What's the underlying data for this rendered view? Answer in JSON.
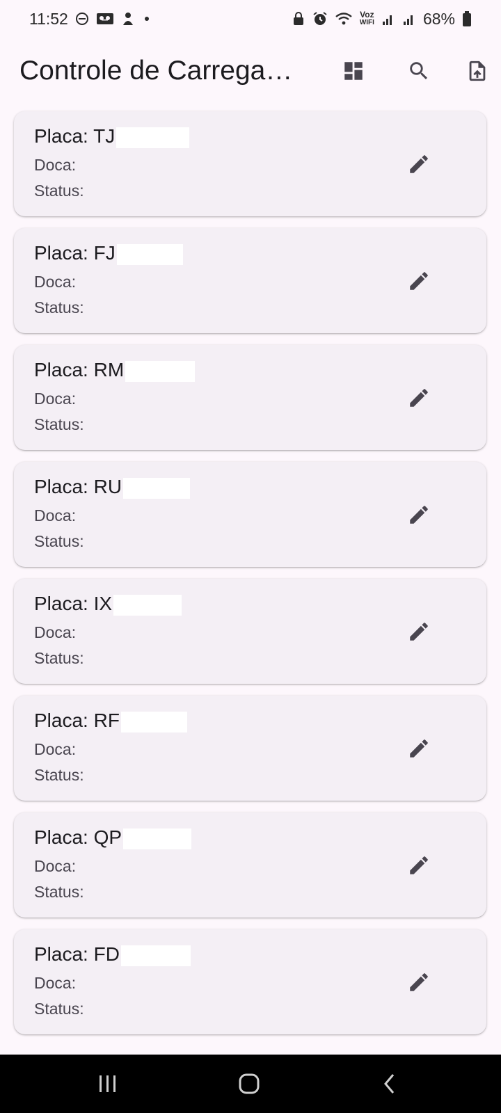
{
  "status_bar": {
    "time": "11:52",
    "battery_percent": "68%",
    "voz_label": "Voz",
    "wifi_label": "WIFI",
    "left_icons": [
      "do-not-disturb-icon",
      "voicemail-icon",
      "notification-icon",
      "more-dot-icon"
    ],
    "right_icons": [
      "lock-icon",
      "alarm-icon",
      "wifi-icon",
      "signal-icon",
      "signal-icon",
      "battery-icon"
    ]
  },
  "app_bar": {
    "title": "Controle de Carregamento",
    "actions": [
      "dashboard-icon",
      "search-icon",
      "export-icon"
    ]
  },
  "labels": {
    "doca": "Doca:",
    "status": "Status:"
  },
  "cards": [
    {
      "plate": "Placa: TJ"
    },
    {
      "plate": "Placa: FJ"
    },
    {
      "plate": "Placa: RM"
    },
    {
      "plate": "Placa: RU"
    },
    {
      "plate": "Placa: IX"
    },
    {
      "plate": "Placa: RF"
    },
    {
      "plate": "Placa: QP"
    },
    {
      "plate": "Placa: FD"
    }
  ],
  "nav_bar": {
    "buttons": [
      "recent-apps-icon",
      "home-icon",
      "back-icon"
    ]
  },
  "colors": {
    "background": "#fdf7fc",
    "card": "#f4eff5",
    "icon": "#49454f",
    "nav": "#000000"
  }
}
